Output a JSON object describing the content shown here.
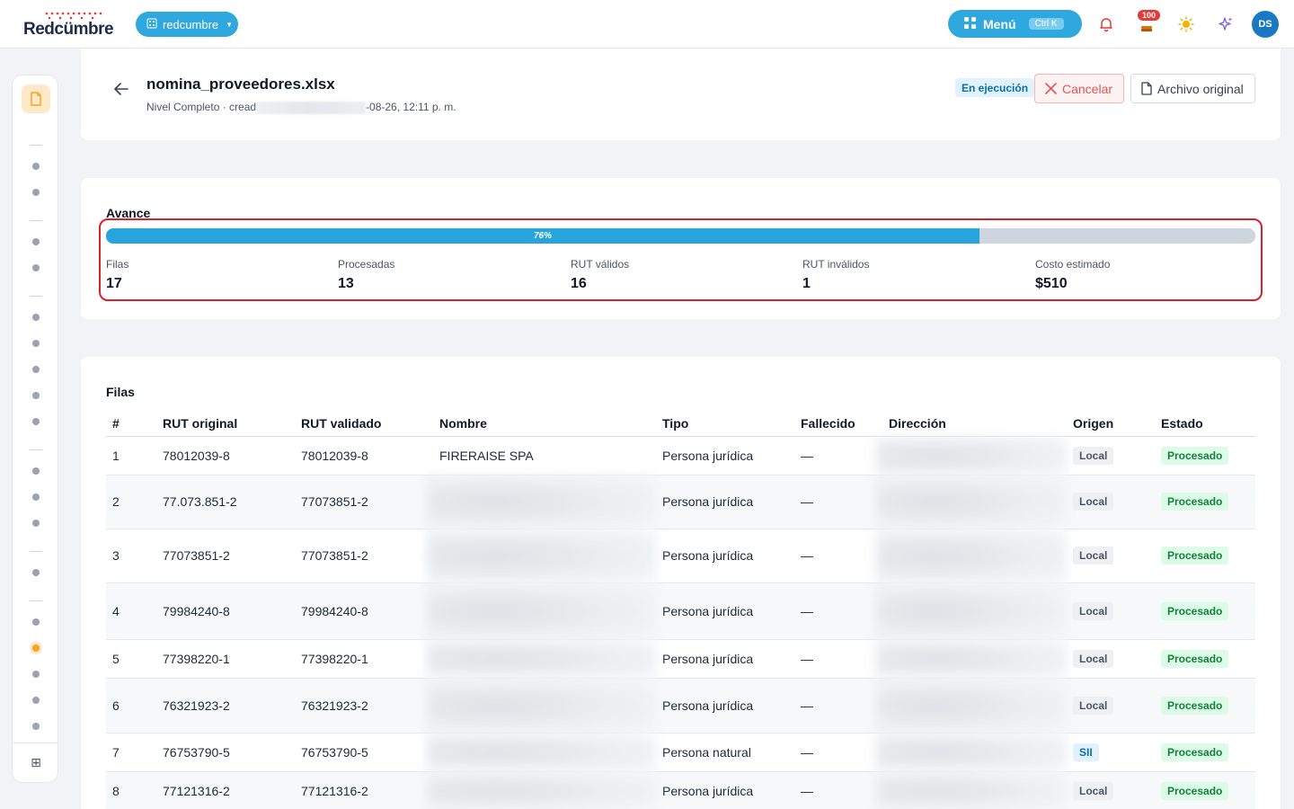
{
  "brand": {
    "logo_text": "Redcümbre",
    "org_name": "redcumbre"
  },
  "header": {
    "menu_label": "Menú",
    "menu_shortcut": "Ctrl K",
    "notification_count": "100",
    "avatar_initials": "DS"
  },
  "job": {
    "title": "nomina_proveedores.xlsx",
    "subtitle_prefix": "Nivel Completo · cread",
    "subtitle_suffix": "-08-26, 12:11 p. m.",
    "status": "En ejecución",
    "cancel_label": "Cancelar",
    "original_label": "Archivo original"
  },
  "progress": {
    "title": "Avance",
    "percent": 76,
    "percent_label": "76%",
    "stats": [
      {
        "label": "Filas",
        "value": "17"
      },
      {
        "label": "Procesadas",
        "value": "13"
      },
      {
        "label": "RUT válidos",
        "value": "16"
      },
      {
        "label": "RUT inválidos",
        "value": "1"
      },
      {
        "label": "Costo estimado",
        "value": "$510"
      }
    ]
  },
  "rows": {
    "title": "Filas",
    "columns": [
      "#",
      "RUT original",
      "RUT validado",
      "Nombre",
      "Tipo",
      "Fallecido",
      "Dirección",
      "Origen",
      "Estado"
    ],
    "items": [
      {
        "n": "1",
        "rut_original": "78012039-8",
        "rut_validado": "78012039-8",
        "nombre": "FIRERAISE SPA",
        "tipo": "Persona jurídica",
        "fallecido": "—",
        "origen": "Local",
        "estado": "Procesado"
      },
      {
        "n": "2",
        "rut_original": "77.073.851-2",
        "rut_validado": "77073851-2",
        "nombre": "",
        "tipo": "Persona jurídica",
        "fallecido": "—",
        "origen": "Local",
        "estado": "Procesado"
      },
      {
        "n": "3",
        "rut_original": "77073851-2",
        "rut_validado": "77073851-2",
        "nombre": "",
        "tipo": "Persona jurídica",
        "fallecido": "—",
        "origen": "Local",
        "estado": "Procesado"
      },
      {
        "n": "4",
        "rut_original": "79984240-8",
        "rut_validado": "79984240-8",
        "nombre": "",
        "tipo": "Persona jurídica",
        "fallecido": "—",
        "origen": "Local",
        "estado": "Procesado"
      },
      {
        "n": "5",
        "rut_original": "77398220-1",
        "rut_validado": "77398220-1",
        "nombre": "",
        "tipo": "Persona jurídica",
        "fallecido": "—",
        "origen": "Local",
        "estado": "Procesado"
      },
      {
        "n": "6",
        "rut_original": "76321923-2",
        "rut_validado": "76321923-2",
        "nombre": "",
        "tipo": "Persona jurídica",
        "fallecido": "—",
        "origen": "Local",
        "estado": "Procesado"
      },
      {
        "n": "7",
        "rut_original": "76753790-5",
        "rut_validado": "76753790-5",
        "nombre": "",
        "tipo": "Persona natural",
        "fallecido": "—",
        "origen": "SII",
        "estado": "Procesado"
      },
      {
        "n": "8",
        "rut_original": "77121316-2",
        "rut_validado": "77121316-2",
        "nombre": "",
        "tipo": "Persona jurídica",
        "fallecido": "—",
        "origen": "Local",
        "estado": "Procesado"
      }
    ]
  },
  "colors": {
    "accent": "#27a4dc",
    "danger": "#d9202c",
    "success": "#15803d",
    "rail_active": "#f5a623"
  }
}
